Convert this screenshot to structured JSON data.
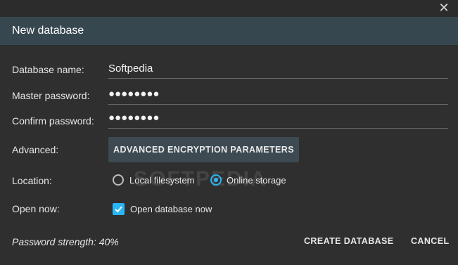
{
  "window": {
    "close_symbol": "✕"
  },
  "dialog": {
    "title": "New database"
  },
  "form": {
    "db_name_label": "Database name:",
    "db_name_value": "Softpedia",
    "master_pw_label": "Master password:",
    "master_pw_value": "●●●●●●●●",
    "confirm_pw_label": "Confirm password:",
    "confirm_pw_value": "●●●●●●●●",
    "advanced_label": "Advanced:",
    "advanced_button": "ADVANCED ENCRYPTION PARAMETERS",
    "location_label": "Location:",
    "location_options": [
      "Local filesystem",
      "Online storage"
    ],
    "location_selected": "Online storage",
    "open_now_label": "Open now:",
    "open_now_checkbox_label": "Open database now",
    "open_now_checked": true
  },
  "footer": {
    "strength_text": "Password strength: 40%",
    "create_button": "CREATE DATABASE",
    "cancel_button": "CANCEL"
  },
  "watermark": "SOFTPEDIA",
  "colors": {
    "accent": "#29b6f6",
    "header": "#37474f",
    "background": "#2f2f2f"
  }
}
